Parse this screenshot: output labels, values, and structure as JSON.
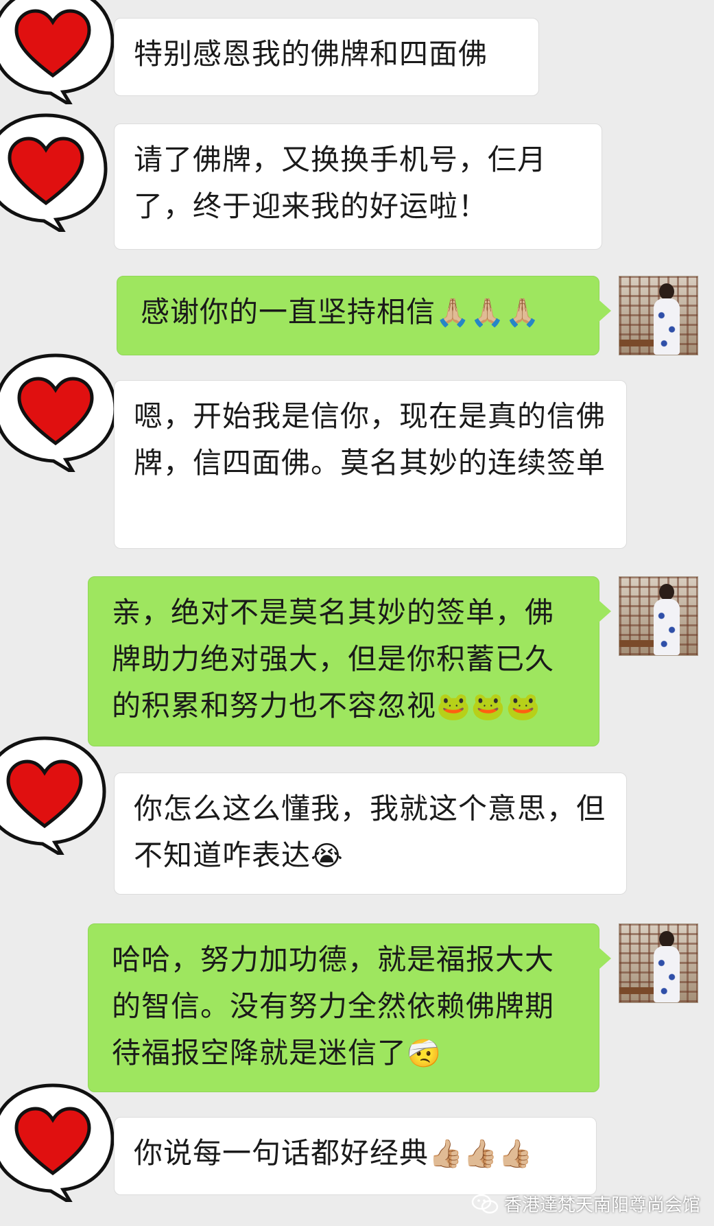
{
  "messages": [
    {
      "side": "in",
      "text": "特别感恩我的佛牌和四面佛"
    },
    {
      "side": "in",
      "text": "请了佛牌，又换换手机号，仨月了，终于迎来我的好运啦！"
    },
    {
      "side": "out",
      "text": "感谢你的一直坚持相信",
      "emoji": "🙏🏼🙏🏼🙏🏼"
    },
    {
      "side": "in",
      "text": "嗯，开始我是信你，现在是真的信佛牌，信四面佛。莫名其妙的连续签单"
    },
    {
      "side": "out",
      "text": "亲，绝对不是莫名其妙的签单，佛牌助力绝对强大，但是你积蓄已久的积累和努力也不容忽视",
      "emoji": "🐸🐸🐸"
    },
    {
      "side": "in",
      "text": "你怎么这么懂我，我就这个意思，但不知道咋表达",
      "emoji": "😭"
    },
    {
      "side": "out",
      "text": "哈哈，努力加功德，就是福报大大的智信。没有努力全然依赖佛牌期待福报空降就是迷信了",
      "emoji": "🤕"
    },
    {
      "side": "in",
      "text": "你说每一句话都好经典",
      "emoji": "👍🏼👍🏼👍🏼"
    }
  ],
  "watermark": {
    "text": "香港達梵天南阳尊尚会馆",
    "icon": "wechat-official-account-icon"
  },
  "colors": {
    "background": "#ececec",
    "incoming": "#ffffff",
    "outgoing": "#9ee65f",
    "heart": "#e01010"
  }
}
